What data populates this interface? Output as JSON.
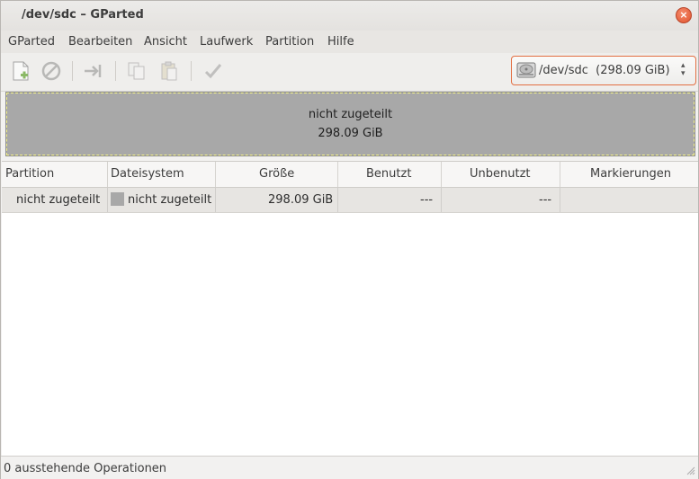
{
  "window": {
    "title": "/dev/sdc – GParted",
    "close_glyph": "×"
  },
  "menubar": {
    "items": [
      "GParted",
      "Bearbeiten",
      "Ansicht",
      "Laufwerk",
      "Partition",
      "Hilfe"
    ]
  },
  "toolbar": {
    "icons": [
      "new-partition-icon",
      "delete-icon",
      "resize-move-icon",
      "copy-icon",
      "paste-icon",
      "apply-icon"
    ],
    "device_selector": {
      "device": "/dev/sdc",
      "size": "(298.09 GiB)",
      "icon": "harddisk-icon"
    }
  },
  "disk_map": {
    "label": "nicht zugeteilt",
    "size": "298.09 GiB",
    "color": "#a8a8a8"
  },
  "table": {
    "headers": [
      "Partition",
      "Dateisystem",
      "Größe",
      "Benutzt",
      "Unbenutzt",
      "Markierungen"
    ],
    "rows": [
      {
        "partition": "nicht zugeteilt",
        "filesystem": "nicht zugeteilt",
        "size": "298.09 GiB",
        "used": "---",
        "unused": "---",
        "flags": ""
      }
    ]
  },
  "status": {
    "text": "0 ausstehende Operationen"
  },
  "colors": {
    "accent": "#e36f42",
    "unallocated": "#a8a8a8",
    "unallocated_border": "#f6f48a"
  }
}
